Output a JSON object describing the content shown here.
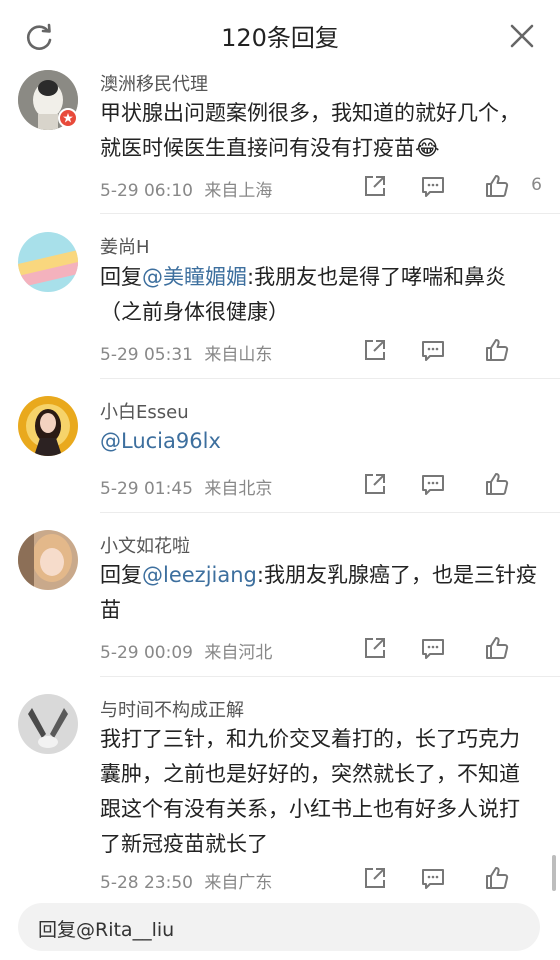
{
  "header": {
    "title": "120条回复",
    "refresh_icon": "refresh-icon",
    "close_icon": "close-icon"
  },
  "comments": [
    {
      "name": "澳洲移民代理",
      "prefix": "",
      "mention": "",
      "text": "甲状腺出问题案例很多，我知道的就好几个，就医时候医生直接问有没有打疫苗😂",
      "time": "5-29 06:10",
      "source": "来自上海",
      "likes": "6"
    },
    {
      "name": "姜尚H",
      "prefix": "回复",
      "mention": "@美瞳媚媚",
      "text": ":我朋友也是得了哮喘和鼻炎（之前身体很健康）",
      "time": "5-29 05:31",
      "source": "来自山东",
      "likes": ""
    },
    {
      "name": "小白Esseu",
      "prefix": "",
      "mention": "@Lucia96lx",
      "text": "",
      "time": "5-29 01:45",
      "source": "来自北京",
      "likes": ""
    },
    {
      "name": "小文如花啦",
      "prefix": "回复",
      "mention": "@leezjiang",
      "text": ":我朋友乳腺癌了，也是三针疫苗",
      "time": "5-29 00:09",
      "source": "来自河北",
      "likes": ""
    },
    {
      "name": "与时间不构成正解",
      "prefix": "",
      "mention": "",
      "text": "我打了三针，和九价交叉着打的，长了巧克力囊肿，之前也是好好的，突然就长了，不知道跟这个有没有关系，小红书上也有好多人说打了新冠疫苗就长了",
      "time": "5-28 23:50",
      "source": "来自广东",
      "likes": ""
    }
  ],
  "reply_bar": {
    "placeholder": "回复@Rita__liu"
  },
  "colors": {
    "mention": "#3d6f9e",
    "icon": "#777777"
  }
}
